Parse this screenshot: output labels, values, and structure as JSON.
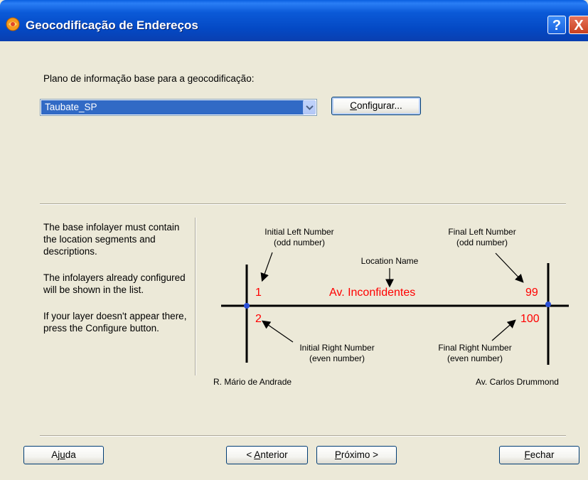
{
  "window": {
    "title": "Geocodificação de Endereços",
    "help_glyph": "?",
    "close_glyph": "X"
  },
  "main": {
    "prompt": "Plano de informação base para a geocodificação:",
    "layer_select": {
      "value": "Taubate_SP"
    },
    "configure_button": {
      "prefix": "",
      "accel": "C",
      "rest": "onfigurar..."
    }
  },
  "info": {
    "paragraphs": [
      "The base infolayer must contain the location segments and descriptions.",
      "The infolayers already configured will be shown in the list.",
      "If your layer doesn't appear there, press the Configure button."
    ]
  },
  "diagram": {
    "initial_left_label": [
      "Initial Left Number",
      "(odd number)"
    ],
    "final_left_label": [
      "Final Left Number",
      "(odd number)"
    ],
    "location_name_label": "Location Name",
    "initial_right_label": [
      "Initial Right Number",
      "(even number)"
    ],
    "final_right_label": [
      "Final Right Number",
      "(even number)"
    ],
    "num_initial_left": "1",
    "num_final_left": "99",
    "num_initial_right": "2",
    "num_final_right": "100",
    "street_name": "Av. Inconfidentes",
    "left_street": "R. Mário de Andrade",
    "right_street": "Av. Carlos Drummond",
    "colors": {
      "numbers": "#ff0000",
      "nodes": "#2a4fd8",
      "lines": "#000000"
    }
  },
  "footer": {
    "help_button": {
      "prefix": "Aj",
      "accel": "u",
      "rest": "da"
    },
    "prev_button": {
      "prefix": "< ",
      "accel": "A",
      "rest": "nterior"
    },
    "next_button": {
      "prefix": "",
      "accel": "P",
      "rest": "róximo >"
    },
    "close_button": {
      "prefix": "",
      "accel": "F",
      "rest": "echar"
    }
  }
}
